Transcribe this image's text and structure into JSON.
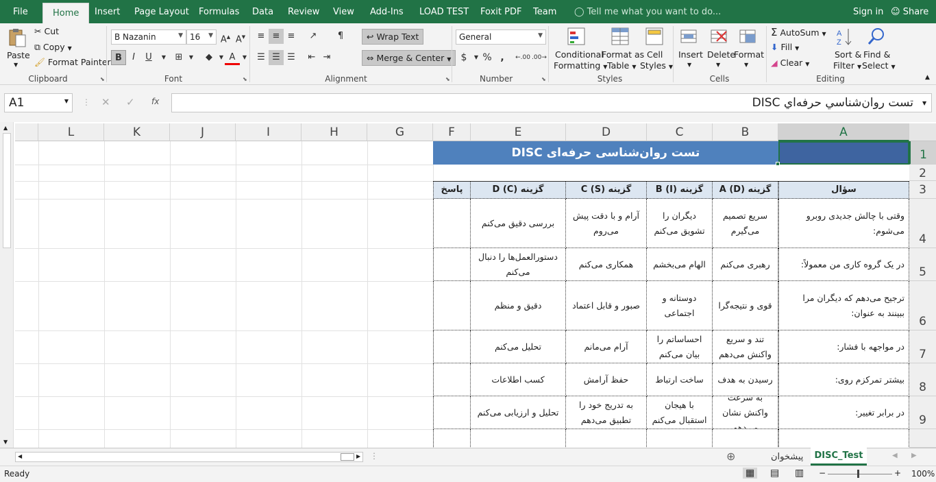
{
  "tabs": {
    "file": "File",
    "items": [
      "Home",
      "Insert",
      "Page Layout",
      "Formulas",
      "Data",
      "Review",
      "View",
      "Add-Ins",
      "LOAD TEST",
      "Foxit PDF",
      "Team"
    ],
    "tell_me": "Tell me what you want to do...",
    "sign_in": "Sign in",
    "share": "Share"
  },
  "clipboard": {
    "paste": "Paste",
    "cut": "Cut",
    "copy": "Copy",
    "format_painter": "Format Painter",
    "label": "Clipboard"
  },
  "font": {
    "name": "B Nazanin",
    "size": "16",
    "bold": "B",
    "italic": "I",
    "underline": "U",
    "label": "Font",
    "font_color": "#ff0000"
  },
  "alignment": {
    "wrap_text": "Wrap Text",
    "merge_center": "Merge & Center",
    "label": "Alignment"
  },
  "number": {
    "format": "General",
    "currency": "$",
    "percent": "%",
    "comma": ",",
    "inc_dec": "←.00",
    "dec_dec": ".00→",
    "label": "Number"
  },
  "styles": {
    "conditional": "Conditional",
    "formatting": "Formatting",
    "format_as": "Format as",
    "table": "Table",
    "cell": "Cell",
    "cell_styles": "Styles",
    "label": "Styles"
  },
  "cells": {
    "insert": "Insert",
    "delete": "Delete",
    "format": "Format",
    "label": "Cells"
  },
  "editing": {
    "autosum": "AutoSum",
    "fill": "Fill",
    "clear": "Clear",
    "sort": "Sort &",
    "filter": "Filter",
    "find": "Find &",
    "select": "Select",
    "label": "Editing"
  },
  "formula_bar": {
    "name_box": "A1",
    "fx": "fx",
    "content": "تست روان‌شناسي حرفه‌اي DISC"
  },
  "columns": [
    "L",
    "K",
    "J",
    "I",
    "H",
    "G",
    "F",
    "E",
    "D",
    "C",
    "B",
    "A"
  ],
  "rows": [
    "1",
    "2",
    "3",
    "4",
    "5",
    "6",
    "7",
    "8",
    "9"
  ],
  "sheet": {
    "title": "تست روان‌شناسی حرفه‌ای DISC",
    "headers": {
      "question": "سؤال",
      "a": "گزینه A (D)",
      "b": "گزینه B (I)",
      "c": "گزینه C (S)",
      "d": "گزینه D (C)",
      "answer": "پاسخ"
    },
    "data": [
      {
        "q": "وقتی با چالش جدیدی روبرو می‌شوم:",
        "a": "سریع تصمیم می‌گیرم",
        "b": "دیگران را تشویق می‌کنم",
        "c": "آرام و با دقت پیش می‌روم",
        "d": "بررسی دقیق می‌کنم"
      },
      {
        "q": "در یک گروه کاری من معمولاً:",
        "a": "رهبری می‌کنم",
        "b": "الهام می‌بخشم",
        "c": "همکاری می‌کنم",
        "d": "دستورالعمل‌ها را دنبال می‌کنم"
      },
      {
        "q": "ترجیح می‌دهم که دیگران مرا ببینند به عنوان:",
        "a": "قوی و نتیجه‌گرا",
        "b": "دوستانه و اجتماعی",
        "c": "صبور و قابل اعتماد",
        "d": "دقیق و منظم"
      },
      {
        "q": "در مواجهه با فشار:",
        "a": "تند و سریع واکنش می‌دهم",
        "b": "احساساتم را بیان می‌کنم",
        "c": "آرام می‌مانم",
        "d": "تحلیل می‌کنم"
      },
      {
        "q": "بیشتر تمرکزم روی:",
        "a": "رسیدن به هدف",
        "b": "ساخت ارتباط",
        "c": "حفظ آرامش",
        "d": "کسب اطلاعات"
      },
      {
        "q": "در برابر تغییر:",
        "a": "به سرعت واکنش نشان می‌دهم",
        "b": "با هیجان استقبال می‌کنم",
        "c": "به تدریج خود را تطبیق می‌دهم",
        "d": "تحلیل و ارزیابی می‌کنم"
      }
    ]
  },
  "sheet_tabs": {
    "active": "DISC_Test",
    "other": "پیشخوان"
  },
  "status": {
    "ready": "Ready",
    "zoom": "100%"
  }
}
